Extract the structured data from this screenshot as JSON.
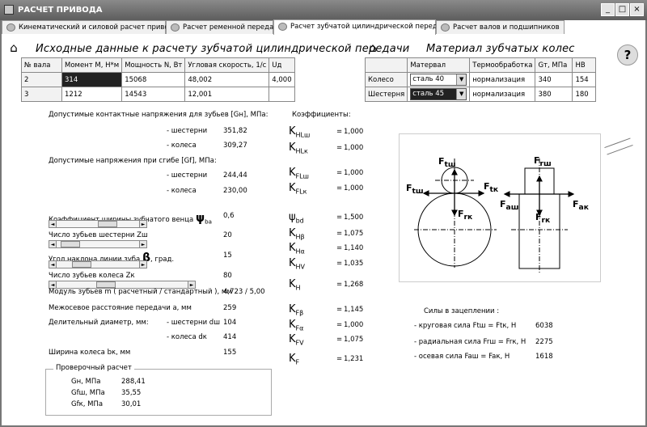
{
  "window": {
    "title": "РАСЧЕТ ПРИВОДА",
    "controls": [
      "_",
      "□",
      "×"
    ]
  },
  "tabs": [
    {
      "label": "Кинематический и силовой расчет привода"
    },
    {
      "label": "Расчет ременной передачи"
    },
    {
      "label": "Расчет зубчатой цилиндрической передачи"
    },
    {
      "label": "Расчет валов и подшипников"
    }
  ],
  "input": {
    "heading": "Исходные данные к расчету зубчатой цилиндрической передачи",
    "columns": [
      "№ вала",
      "Момент М, Н*м",
      "Мощность N, Вт",
      "Угловая скорость, 1/с",
      "Uд"
    ],
    "rows": [
      [
        "2",
        "314",
        "15068",
        "48,002",
        "4,000"
      ],
      [
        "3",
        "1212",
        "14543",
        "12,001",
        ""
      ]
    ]
  },
  "material": {
    "heading": "Материал зубчатых колес",
    "columns": [
      "",
      "Матервал",
      "Термообработка",
      "Gт, МПа",
      "HB"
    ],
    "rows": [
      [
        "Колесо",
        "сталь 40",
        "нормализация",
        "340",
        "154"
      ],
      [
        "Шестерня",
        "сталь 45",
        "нормализация",
        "380",
        "180"
      ]
    ],
    "help_icon": "question-icon"
  },
  "stress": {
    "contact_title": "Допустимые контактные напряжения для зубьев [Gн], МПа:",
    "contact_gear_label": "- шестерни",
    "contact_gear": "351,82",
    "contact_wheel_label": "- колеса",
    "contact_wheel": "309,27",
    "bend_title": "Допустимые напряжения при сгибе [Gf], МПа:",
    "bend_gear_label": "- шестерни",
    "bend_gear": "244,44",
    "bend_wheel_label": "- колеса",
    "bend_wheel": "230,00"
  },
  "params": {
    "width_coef_label": "Коэффициент ширины зубчатого венца",
    "width_coef_sym": "ψ",
    "width_coef_sub": "ba",
    "width_coef": "0,6",
    "teeth_gear_label": "Число зубьев шестерни Zш",
    "teeth_gear": "20",
    "helix_label": "Угол наклона линии зуба",
    "helix_sym": "β",
    "helix_unit": ", град.",
    "helix": "15",
    "teeth_wheel_label": "Число зубьев колеса Zк",
    "teeth_wheel": "80",
    "module_label": "Модуль зубьев m ( расчетный / стандартный ), мм",
    "module": "4,723 / 5,00",
    "center_label": "Межосевое расстояние передачи а, мм",
    "center": "259",
    "pitch_label": "Делительный диаметр, мм:",
    "pitch_gear_label": "- шестерни dш",
    "pitch_gear": "104",
    "pitch_wheel_label": "- колеса dк",
    "pitch_wheel": "414",
    "face_label": "Ширина колеса bк, мм",
    "face": "155"
  },
  "check": {
    "title": "Проверочный расчет",
    "rows": [
      [
        "Gн, МПа",
        "288,41"
      ],
      [
        "Gfш, МПа",
        "35,55"
      ],
      [
        "Gfк, МПа",
        "30,01"
      ]
    ]
  },
  "coefficients": {
    "title": "Коэффициенты:",
    "items": [
      {
        "k": "K",
        "sub": "HLш",
        "eq": "=",
        "val": "1,000"
      },
      {
        "k": "K",
        "sub": "HLк",
        "eq": "=",
        "val": "1,000"
      },
      {
        "k": "K",
        "sub": "FLш",
        "eq": "=",
        "val": "1,000"
      },
      {
        "k": "K",
        "sub": "FLк",
        "eq": "=",
        "val": "1,000"
      },
      {
        "k": "ψ",
        "sub": "bd",
        "eq": "=",
        "val": "1,500"
      },
      {
        "k": "K",
        "sub": "Hβ",
        "eq": "=",
        "val": "1,075"
      },
      {
        "k": "K",
        "sub": "Hα",
        "eq": "=",
        "val": "1,140"
      },
      {
        "k": "K",
        "sub": "HV",
        "eq": "=",
        "val": "1,035"
      },
      {
        "k": "K",
        "sub": "H",
        "eq": "=",
        "val": "1,268"
      },
      {
        "k": "K",
        "sub": "Fβ",
        "eq": "=",
        "val": "1,145"
      },
      {
        "k": "K",
        "sub": "Fα",
        "eq": "=",
        "val": "1,000"
      },
      {
        "k": "K",
        "sub": "FV",
        "eq": "=",
        "val": "1,075"
      },
      {
        "k": "K",
        "sub": "F",
        "eq": "=",
        "val": "1,231"
      }
    ]
  },
  "diagram": {
    "labels": {
      "ftsh": "F",
      "ftsh_sub": "tш",
      "ftk": "F",
      "ftk_sub": "tк",
      "frk": "F",
      "frk_sub": "rк",
      "ftsh2": "F",
      "ftsh2_sub": "tш",
      "fash": "F",
      "fash_sub": "aш",
      "frk2": "F",
      "frk2_sub": "rк",
      "fak": "F",
      "fak_sub": "aк",
      "frsh": "F",
      "frsh_sub": "rш"
    }
  },
  "forces": {
    "title": "Силы в зацеплении :",
    "items": [
      {
        "label": "- круговая сила Ftш = Ftк, Н",
        "value": "6038"
      },
      {
        "label": "- радиальная сила Frш = Frк, Н",
        "value": "2275"
      },
      {
        "label": "- осевая сила Faш = Faк, Н",
        "value": "1618"
      }
    ]
  }
}
